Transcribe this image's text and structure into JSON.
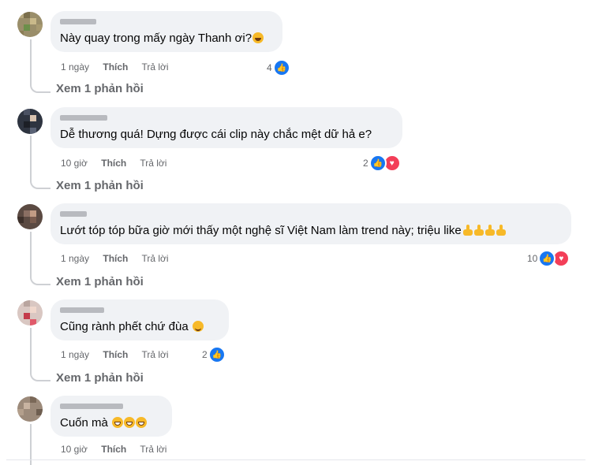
{
  "comments": [
    {
      "author": "Redacted name",
      "text": "Này quay trong mấy ngày Thanh ơi?",
      "emoji": [
        "laughing-crying"
      ],
      "time": "1 ngày",
      "like_label": "Thích",
      "reply_label": "Trả lời",
      "reaction_count": "4",
      "reactions": [
        "like"
      ],
      "view_replies": "Xem 1 phản hồi"
    },
    {
      "author": "Redacted name",
      "text": "Dễ thương quá! Dựng được cái clip này chắc mệt dữ hả e?",
      "emoji": [],
      "time": "10 giờ",
      "like_label": "Thích",
      "reply_label": "Trả lời",
      "reaction_count": "2",
      "reactions": [
        "like",
        "love"
      ],
      "view_replies": "Xem 1 phản hồi"
    },
    {
      "author": "Redacted name",
      "text": "Lướt tóp tóp bữa giờ mới thấy một nghệ sĩ Việt Nam làm trend này; triệu like",
      "emoji": [
        "thumbs-up",
        "thumbs-up",
        "thumbs-up",
        "thumbs-up"
      ],
      "time": "1 ngày",
      "like_label": "Thích",
      "reply_label": "Trả lời",
      "reaction_count": "10",
      "reactions": [
        "like",
        "love"
      ],
      "view_replies": "Xem 1 phản hồi"
    },
    {
      "author": "Redacted name",
      "text": "Cũng rành phết chứ đùa",
      "emoji": [
        "smiling-face"
      ],
      "time": "1 ngày",
      "like_label": "Thích",
      "reply_label": "Trả lời",
      "reaction_count": "2",
      "reactions": [
        "like"
      ],
      "view_replies": "Xem 1 phản hồi"
    },
    {
      "author": "Redacted name",
      "text": "Cuốn mà",
      "emoji": [
        "grinning-face",
        "grinning-face",
        "grinning-face"
      ],
      "time": "10 giờ",
      "like_label": "Thích",
      "reply_label": "Trả lời",
      "reaction_count": "",
      "reactions": [],
      "view_replies": ""
    }
  ],
  "colors": {
    "bubble": "#f0f2f5",
    "like_blue": "#1877f2",
    "love_red": "#f33e58",
    "secondary_text": "#65676b"
  }
}
